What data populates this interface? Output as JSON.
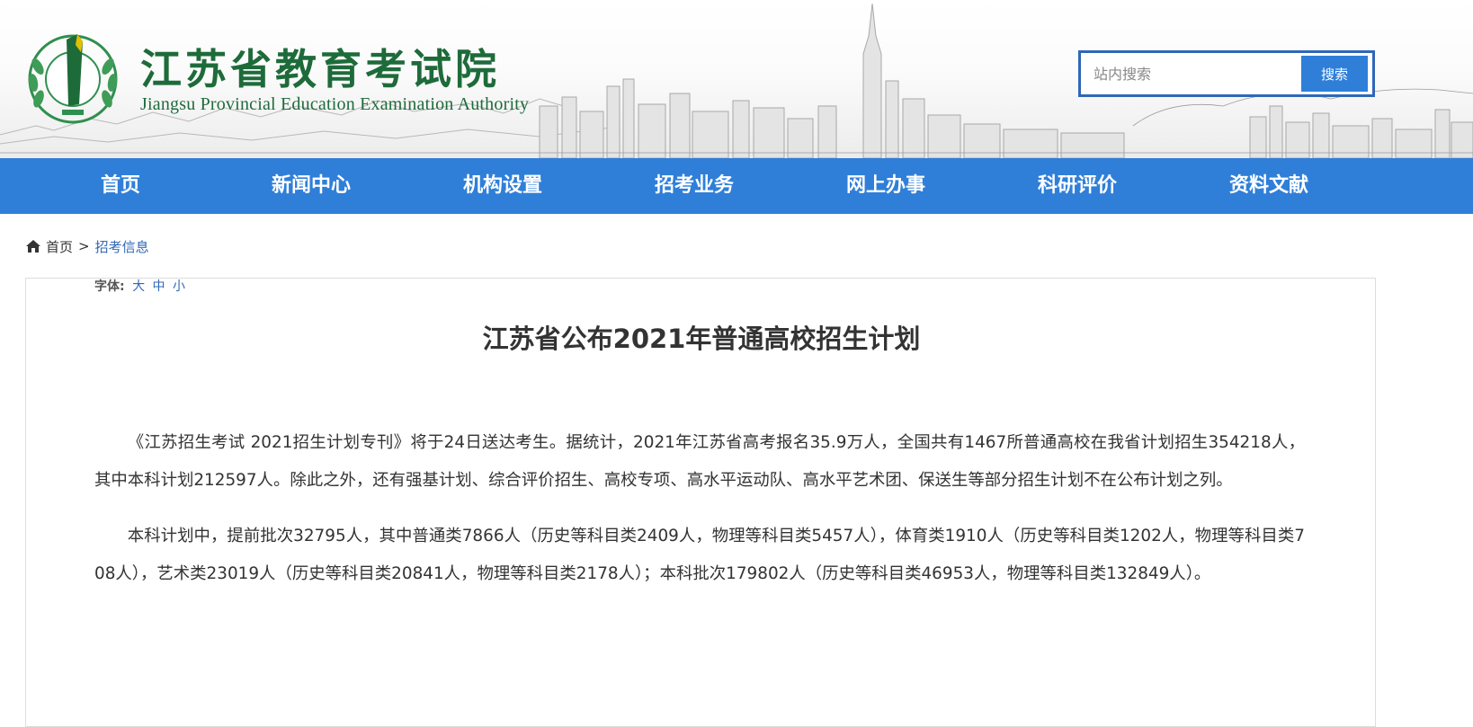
{
  "header": {
    "logo_cn": "江苏省教育考试院",
    "logo_en": "Jiangsu Provincial Education Examination Authority",
    "search": {
      "placeholder": "站内搜索",
      "button_label": "搜索"
    }
  },
  "nav": {
    "items": [
      {
        "label": "首页"
      },
      {
        "label": "新闻中心"
      },
      {
        "label": "机构设置"
      },
      {
        "label": "招考业务"
      },
      {
        "label": "网上办事"
      },
      {
        "label": "科研评价"
      },
      {
        "label": "资料文献"
      }
    ]
  },
  "breadcrumb": {
    "home": "首页",
    "separator": ">",
    "current": "招考信息"
  },
  "article": {
    "font_size_label": "字体:",
    "font_size_options": [
      "大",
      "中",
      "小"
    ],
    "title": "江苏省公布2021年普通高校招生计划",
    "paragraphs": [
      "《江苏招生考试 2021招生计划专刊》将于24日送达考生。据统计，2021年江苏省高考报名35.9万人，全国共有1467所普通高校在我省计划招生354218人，其中本科计划212597人。除此之外，还有强基计划、综合评价招生、高校专项、高水平运动队、高水平艺术团、保送生等部分招生计划不在公布计划之列。",
      "本科计划中，提前批次32795人，其中普通类7866人（历史等科目类2409人，物理等科目类5457人），体育类1910人（历史等科目类1202人，物理等科目类708人），艺术类23019人（历史等科目类20841人，物理等科目类2178人）；本科批次179802人（历史等科目类46953人，物理等科目类132849人）。"
    ]
  },
  "colors": {
    "nav_blue": "#2f7fd9",
    "logo_green": "#1e6b3a",
    "link_blue": "#2f67b8",
    "search_border": "#2f67b8"
  }
}
